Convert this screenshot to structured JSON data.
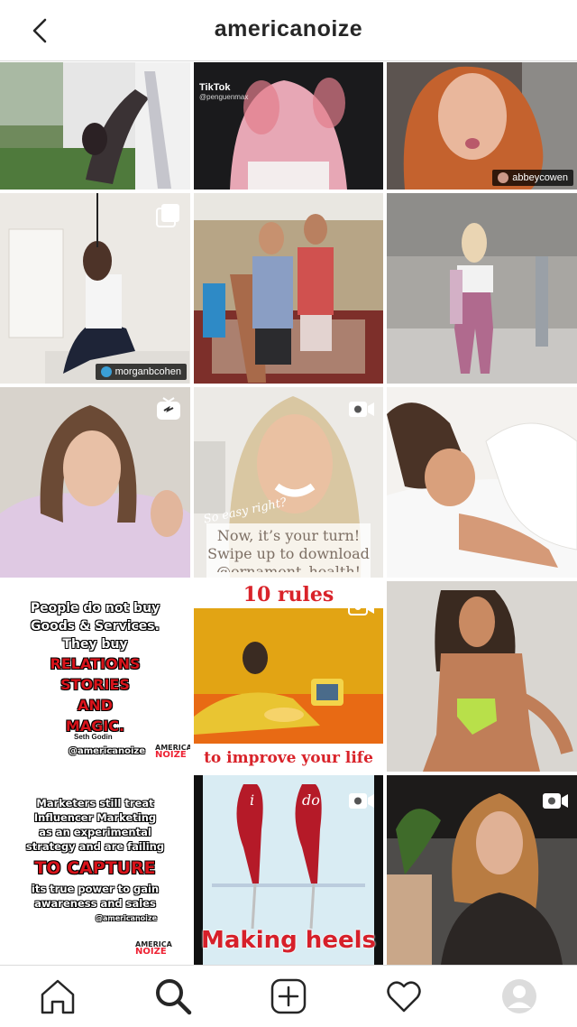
{
  "header": {
    "username": "americanoize"
  },
  "posts": [
    {
      "credit": ""
    },
    {
      "tiktok_label": "TikTok",
      "tiktok_handle": "@penguenmax"
    },
    {
      "credit": "abbeycowen"
    },
    {
      "credit": "morganbcohen"
    },
    {
      "credit": ""
    },
    {
      "credit": ""
    },
    {
      "credit": ""
    },
    {
      "caption_small": "So easy right?",
      "caption_line1": "Now, it’s your turn!",
      "caption_line2": "Swipe up to download",
      "caption_line3": "@ornament_health!"
    },
    {
      "credit": ""
    },
    {
      "line1": "People do not buy",
      "line2": "Goods & Services.",
      "line3": "They buy",
      "line4": "RELATIONS",
      "line5": "STORIES",
      "line6": "AND",
      "line7": "MAGIC.",
      "author": "Seth Godin",
      "handle": "@americanoize",
      "brand_top": "AMERICA",
      "brand_bottom": "NOIZE"
    },
    {
      "title": "10 rules",
      "subtitle": "to improve your life"
    },
    {
      "credit": ""
    },
    {
      "line1": "Marketers still treat",
      "line2": "Influencer Marketing",
      "line3": "as an experimental",
      "line4": "strategy and are failing",
      "line5": "TO CAPTURE",
      "line6": "its true power to gain",
      "line7": "awareness and sales",
      "handle": "@americanoize",
      "brand_top": "AMERICA",
      "brand_bottom": "NOIZE"
    },
    {
      "left_shoe": "i",
      "right_shoe": "do",
      "caption": "Making heels"
    },
    {
      "credit": ""
    }
  ],
  "nav": {
    "items": [
      "home-icon",
      "search-icon",
      "add-post-icon",
      "heart-icon",
      "profile-avatar"
    ]
  },
  "colors": {
    "accent_red": "#d9141b",
    "border": "#dbdbdb",
    "text": "#262626"
  }
}
